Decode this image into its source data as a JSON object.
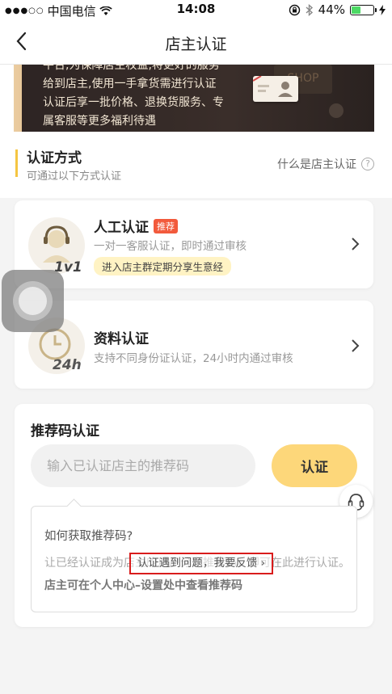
{
  "status_bar": {
    "carrier": "中国电信",
    "time": "14:08",
    "battery": "44%",
    "battery_level": 0.44
  },
  "nav": {
    "title": "店主认证"
  },
  "banner": {
    "line1": "平台,为保障店主权益,将更好的服务",
    "line2": "给到店主,使用一手拿货需进行认证",
    "line3": "认证后享一批价格、退换货服务、专",
    "line4": "属客服等更多福利待遇",
    "card_text": "SHOP"
  },
  "section": {
    "title": "认证方式",
    "subtitle": "可通过以下方式认证",
    "help_label": "什么是店主认证"
  },
  "methods": [
    {
      "title": "人工认证",
      "tag": "推荐",
      "desc": "一对一客服认证，即时通过审核",
      "pill": "进入店主群定期分享生意经",
      "badge": "1v1"
    },
    {
      "title": "资料认证",
      "desc": "支持不同身份证认证，24小时内通过审核",
      "badge": "24h"
    }
  ],
  "referral": {
    "title": "推荐码认证",
    "placeholder": "输入已认证店主的推荐码",
    "button": "认证",
    "tip_question": "如何获取推荐码?",
    "tip_answer_prefix": "让已经认证成为店主的用户分享推荐码，即可在此进行认证。",
    "tip_answer_bold": "店主可在个人中心–设置处中查看推荐码"
  },
  "overlay": {
    "feedback_label": "认证遇到问题，我要反馈 ›"
  },
  "colors": {
    "accent_yellow": "#fdd77a",
    "section_bar": "#f5c542",
    "tag_red": "#f25a3c",
    "highlight_red": "#d91c1c"
  }
}
